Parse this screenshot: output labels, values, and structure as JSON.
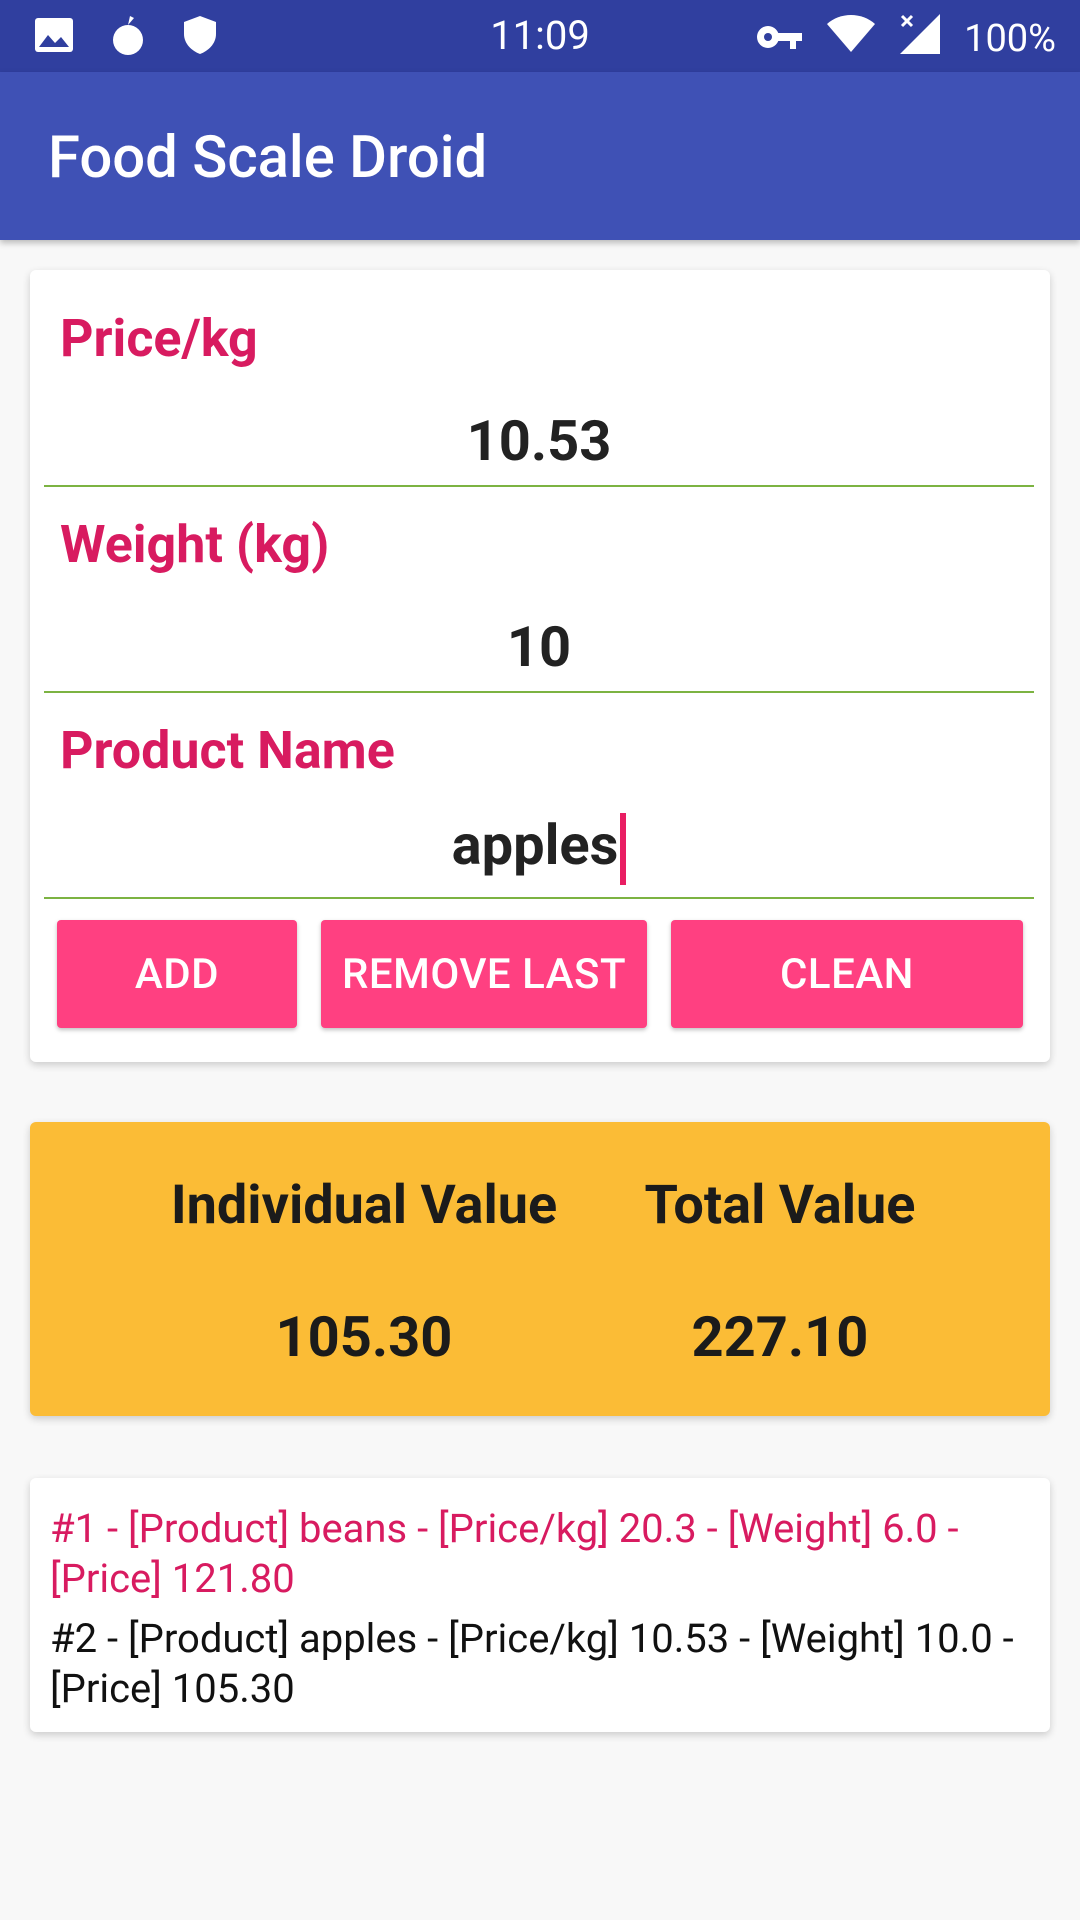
{
  "status_bar": {
    "time": "11:09",
    "battery": "100%",
    "left_icons": [
      "image-icon",
      "fruit-icon",
      "shield-icon"
    ],
    "right_icons": [
      "key-icon",
      "wifi-icon",
      "signal-icon"
    ]
  },
  "app_bar": {
    "title": "Food Scale Droid"
  },
  "form": {
    "price_label": "Price/kg",
    "price_value": "10.53",
    "weight_label": "Weight (kg)",
    "weight_value": "10",
    "product_label": "Product Name",
    "product_value": "apples"
  },
  "buttons": {
    "add": "ADD",
    "remove_last": "REMOVE LAST",
    "clean": "CLEAN"
  },
  "summary": {
    "individual_label": "Individual Value",
    "individual_value": "105.30",
    "total_label": "Total Value",
    "total_value": "227.10"
  },
  "entries": [
    {
      "text": "#1 - [Product] beans - [Price/kg] 20.3 - [Weight] 6.0 - [Price] 121.80"
    },
    {
      "text": "#2 - [Product] apples - [Price/kg] 10.53 - [Weight] 10.0 - [Price] 105.30"
    }
  ],
  "colors": {
    "status_bar": "#303f9f",
    "app_bar": "#3f51b5",
    "accent": "#ff4081",
    "label": "#d81b60",
    "summary_bg": "#fbbc36",
    "underline": "#7cb342"
  }
}
